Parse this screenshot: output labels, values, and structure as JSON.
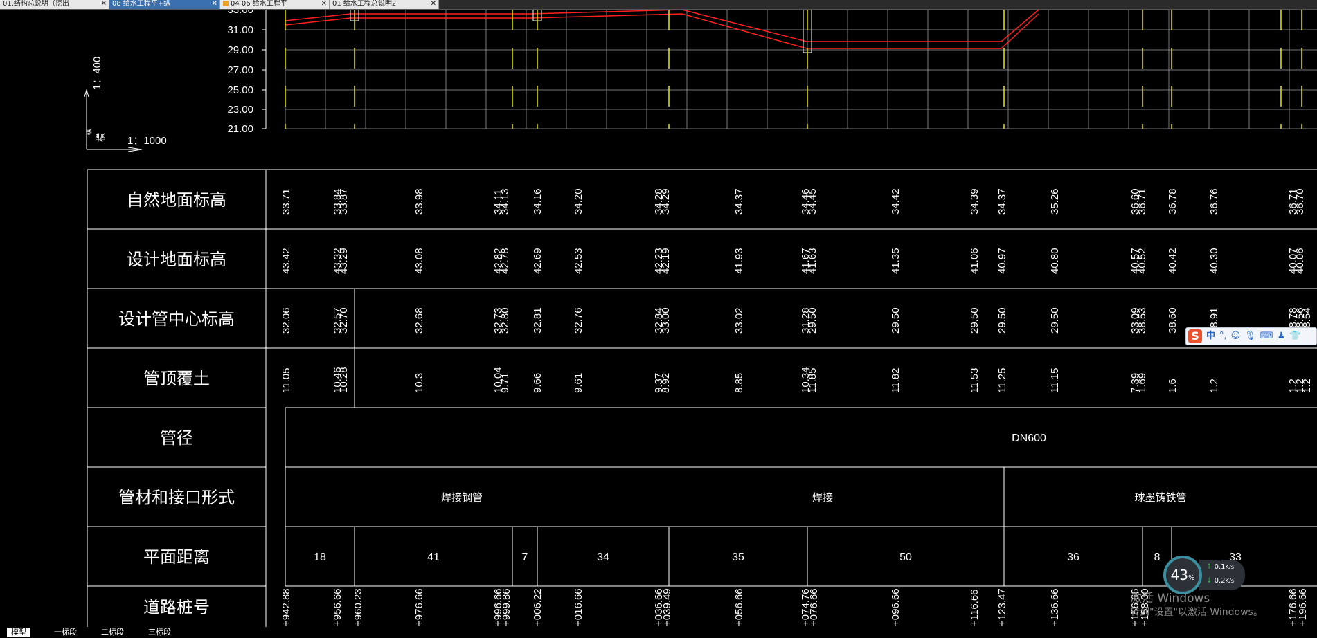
{
  "doc_tabs": [
    {
      "label": "01.结构总说明（挖出"
    },
    {
      "label": "08 给水工程平+纵"
    },
    {
      "label": "04 06 给水工程平"
    },
    {
      "label": "01 给水工程总说明2"
    }
  ],
  "profile": {
    "y_ticks": [
      "33.00",
      "31.00",
      "29.00",
      "27.00",
      "25.00",
      "23.00",
      "21.00"
    ],
    "scale_vertical": "1：400",
    "scale_vertical_label": "纵",
    "scale_horizontal": "1：1000",
    "scale_horizontal_label": "横"
  },
  "table": {
    "row_labels": [
      "自然地面标高",
      "设计地面标高",
      "设计管中心标高",
      "管顶覆土",
      "管径",
      "管材和接口形式",
      "平面距离",
      "道路桩号"
    ],
    "natural_ground": [
      "33.71",
      "33.84",
      "33.87",
      "33.98",
      "34.11",
      "34.13",
      "34.16",
      "34.20",
      "34.28",
      "34.29",
      "34.37",
      "34.46",
      "34.45",
      "34.42",
      "34.39",
      "34.37",
      "35.26",
      "36.60",
      "36.71",
      "36.78",
      "36.76",
      "36.71",
      "36.70"
    ],
    "design_ground": [
      "43.42",
      "43.32",
      "43.29",
      "43.08",
      "42.82",
      "42.78",
      "42.69",
      "42.53",
      "42.23",
      "42.19",
      "41.93",
      "41.67",
      "41.63",
      "41.35",
      "41.06",
      "40.97",
      "40.80",
      "40.57",
      "40.52",
      "40.42",
      "40.30",
      "40.07",
      "40.06"
    ],
    "pipe_center": [
      "32.06",
      "32.57",
      "32.70",
      "32.68",
      "32.73",
      "32.80",
      "32.81",
      "32.76",
      "32.84",
      "33.00",
      "33.02",
      "31.28",
      "29.50",
      "29.50",
      "29.50",
      "29.50",
      "29.50",
      "33.09",
      "38.53",
      "38.60",
      "38.91",
      "38.78",
      "38.56",
      "38.54"
    ],
    "cover": [
      "11.05",
      "10.46",
      "10.28",
      "10.3",
      "10.04",
      "9.71",
      "9.66",
      "9.61",
      "9.37",
      "8.92",
      "8.85",
      "10.34",
      "11.85",
      "11.82",
      "11.53",
      "11.25",
      "11.15",
      "7.39",
      "1.69",
      "1.6",
      "1.2",
      "1.2",
      "1.2",
      "1.2"
    ],
    "diameter": "DN600",
    "material": [
      "焊接钢管",
      "焊接",
      "球墨铸铁管"
    ],
    "distances": [
      "18",
      "41",
      "7",
      "34",
      "35",
      "50",
      "36",
      "8",
      "33"
    ],
    "stations": [
      "+942.88",
      "+956.66",
      "+960.23",
      "+976.66",
      "+996.66",
      "+999.86",
      "+006.22",
      "+016.66",
      "+036.66",
      "+039.49",
      "+056.66",
      "+074.76",
      "+076.66",
      "+096.66",
      "+116.66",
      "+123.47",
      "+136.66",
      "+156.66",
      "+158.00",
      "+176.66",
      "+196.66"
    ]
  },
  "layout_tabs": [
    {
      "label": "模型"
    },
    {
      "label": "一标段"
    },
    {
      "label": "二标段"
    },
    {
      "label": "三标段"
    }
  ],
  "ime": {
    "mode": "中",
    "punct": "°,"
  },
  "netmon": {
    "percent": "43",
    "unit": "%",
    "up_rate": "0.1",
    "down_rate": "0.2",
    "rate_unit": "K/s"
  },
  "watermark": {
    "line1": "激活 Windows",
    "line2": "转到\"设置\"以激活 Windows。"
  },
  "colors": {
    "grid": "#9a9a9a",
    "profile_line": "#ff2020",
    "marker": "#e8e800",
    "table_line": "#ffffff"
  }
}
